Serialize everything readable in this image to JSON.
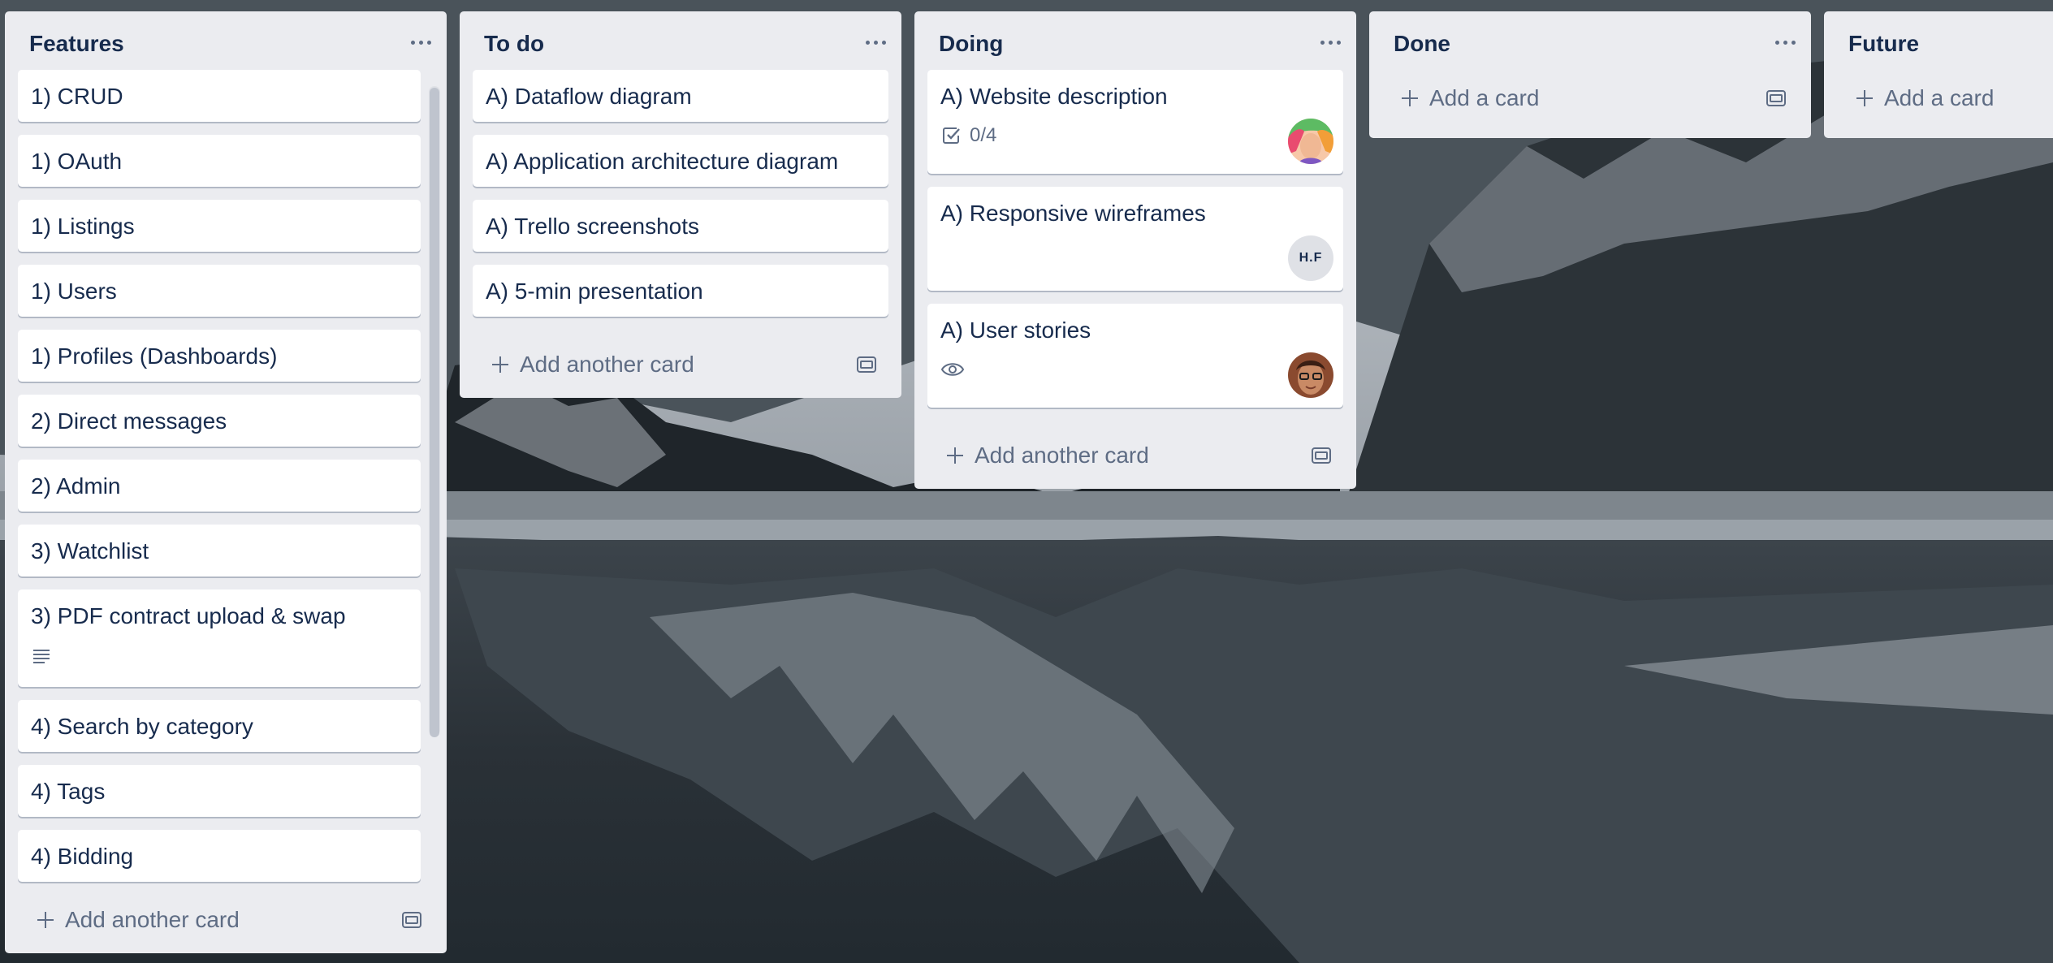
{
  "board": {
    "lists": [
      {
        "title": "Features",
        "cards": [
          "1) CRUD",
          "1) OAuth",
          "1) Listings",
          "1) Users",
          "1) Profiles (Dashboards)",
          "2) Direct messages",
          "2) Admin",
          "3) Watchlist",
          "3) PDF contract upload & swap",
          "4) Search by category",
          "4) Tags",
          "4) Bidding"
        ],
        "add_label": "Add another card"
      },
      {
        "title": "To do",
        "cards": [
          "A) Dataflow diagram",
          "A) Application architecture diagram",
          "A) Trello screenshots",
          "A) 5-min presentation"
        ],
        "add_label": "Add another card"
      },
      {
        "title": "Doing",
        "cards": [
          "A) Website description",
          "A) Responsive wireframes",
          "A) User stories"
        ],
        "checklist": "0/4",
        "avatar_initials": "H.F",
        "add_label": "Add another card"
      },
      {
        "title": "Done",
        "add_label": "Add a card"
      },
      {
        "title": "Future",
        "add_label": "Add a card"
      }
    ]
  },
  "icons": {
    "list_menu": "more-horizontal-icon",
    "add": "plus-icon",
    "template": "card-template-icon",
    "description": "description-icon",
    "checklist": "checklist-icon",
    "watch": "eye-icon"
  },
  "colors": {
    "list_bg": "#ebecf0",
    "card_bg": "#ffffff",
    "text": "#172b4d",
    "muted": "#5e6c84"
  }
}
